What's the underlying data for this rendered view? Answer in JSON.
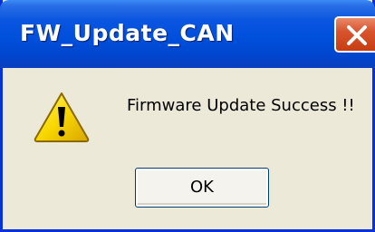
{
  "dialog": {
    "title": "FW_Update_CAN",
    "message": "Firmware Update Success !!",
    "ok_label": "OK",
    "icon": "warning-icon",
    "close_icon": "close-icon"
  },
  "colors": {
    "titlebar": "#0050dc",
    "border": "#0831d9",
    "body": "#ece9d8",
    "close": "#d8542e",
    "warning_fill": "#f8d800"
  }
}
